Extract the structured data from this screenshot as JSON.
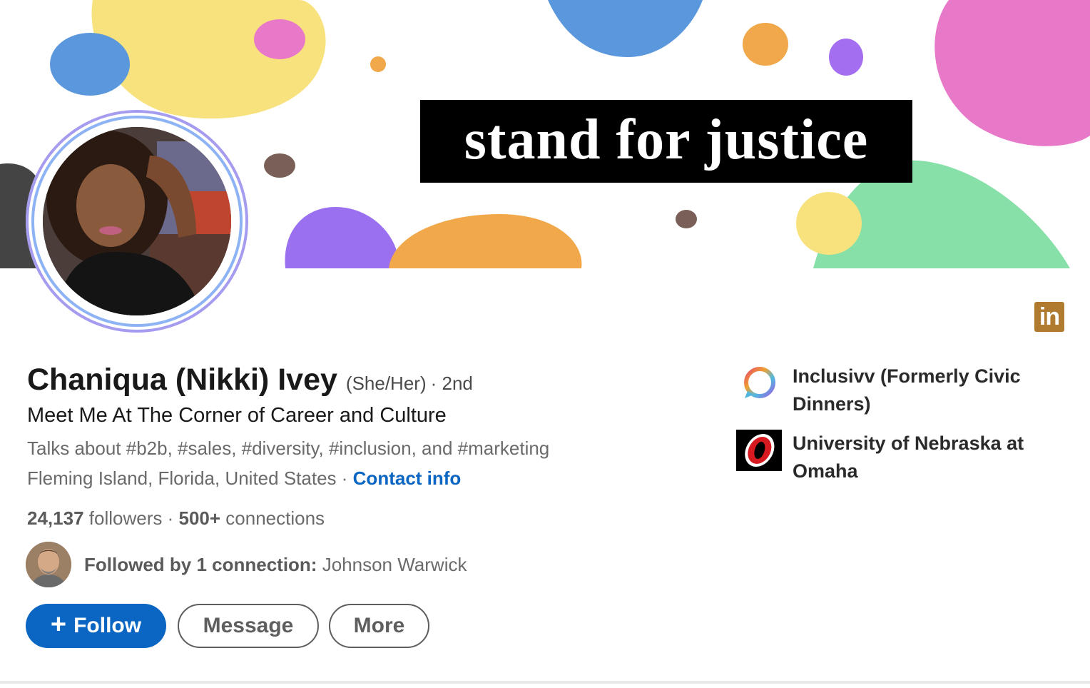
{
  "banner": {
    "title": "stand for justice"
  },
  "profile": {
    "name": "Chaniqua (Nikki) Ivey",
    "pronouns": "(She/Her)",
    "degree": "· 2nd",
    "headline": "Meet Me At The Corner of Career and Culture",
    "talks_about": "Talks about #b2b, #sales, #diversity, #inclusion, and #marketing",
    "location": "Fleming Island, Florida, United States",
    "location_separator": " · ",
    "contact_info_label": "Contact info",
    "followers_count": "24,137",
    "followers_label": "followers",
    "stats_separator": " · ",
    "connections_count": "500+",
    "connections_label": "connections",
    "followed_by_label": "Followed by 1 connection:",
    "followed_by_name": "Johnson Warwick"
  },
  "actions": {
    "follow_plus": "+",
    "follow_label": "Follow",
    "message_label": "Message",
    "more_label": "More"
  },
  "linkedin_badge": {
    "text": "in",
    "icon": "linkedin-icon",
    "color": "#b07a2f"
  },
  "organizations": [
    {
      "name": "Inclusivv (Formerly Civic Dinners)",
      "icon": "inclusivv-logo"
    },
    {
      "name": "University of Nebraska at Omaha",
      "icon": "unomaha-logo"
    }
  ],
  "colors": {
    "accent": "#0a66c2",
    "text_primary": "#191919",
    "text_secondary": "#6a6a6a"
  }
}
